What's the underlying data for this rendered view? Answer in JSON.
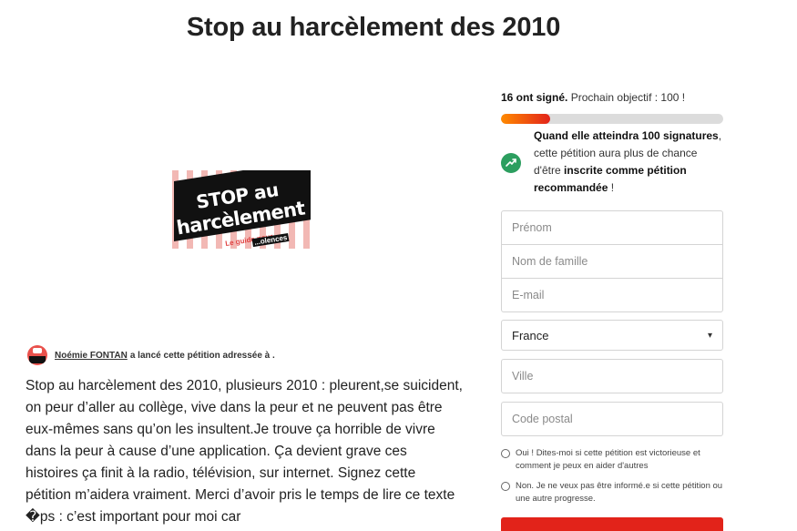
{
  "page": {
    "title": "Stop au harcèlement des 2010"
  },
  "hero": {
    "line1": "STOP au",
    "line2": "harcèlement !",
    "line3": "Le guide pour",
    "line4": "...olences"
  },
  "author": {
    "name": "Noémie FONTAN",
    "action": "a lancé cette pétition adressée à ."
  },
  "body": {
    "text": "Stop au harcèlement des 2010, plusieurs 2010 : pleurent,se suicident, on peur d’aller au collège, vive dans la peur et ne peuvent pas être eux-mêmes sans qu’on les insultent.Je trouve ça horrible de vivre dans la peur à cause d’une application. Ça devient grave ces histoires ça finit à la radio, télévision, sur internet. Signez cette pétition m’aidera vraiment. Merci d’avoir pris le temps de lire ce texte �ps : c’est important pour moi car"
  },
  "signatures": {
    "count_text": "16 ont signé.",
    "goal_text": "Prochain objectif : 100 !",
    "progress": 0.22,
    "goal_bold_1": "Quand elle atteindra 100 signatures",
    "goal_mid": ", cette pétition aura plus de chance d'être ",
    "goal_bold_2": "inscrite comme pétition recommandée",
    "goal_end": " !"
  },
  "form": {
    "first_name_placeholder": "Prénom",
    "last_name_placeholder": "Nom de famille",
    "email_placeholder": "E-mail",
    "country_value": "France",
    "city_placeholder": "Ville",
    "postal_placeholder": "Code postal",
    "opt_in_label": "Oui ! Dites-moi si cette pétition est victorieuse et comment je peux en aider d'autres",
    "opt_out_label": "Non. Je ne veux pas être informé.e si cette pétition ou une autre progresse."
  },
  "colors": {
    "accent": "#e2231a",
    "progress_start": "#ff8a00",
    "goal_icon": "#2c9e5f"
  },
  "icons": {
    "goal": "trending-up-icon",
    "select": "chevron-down-icon"
  }
}
